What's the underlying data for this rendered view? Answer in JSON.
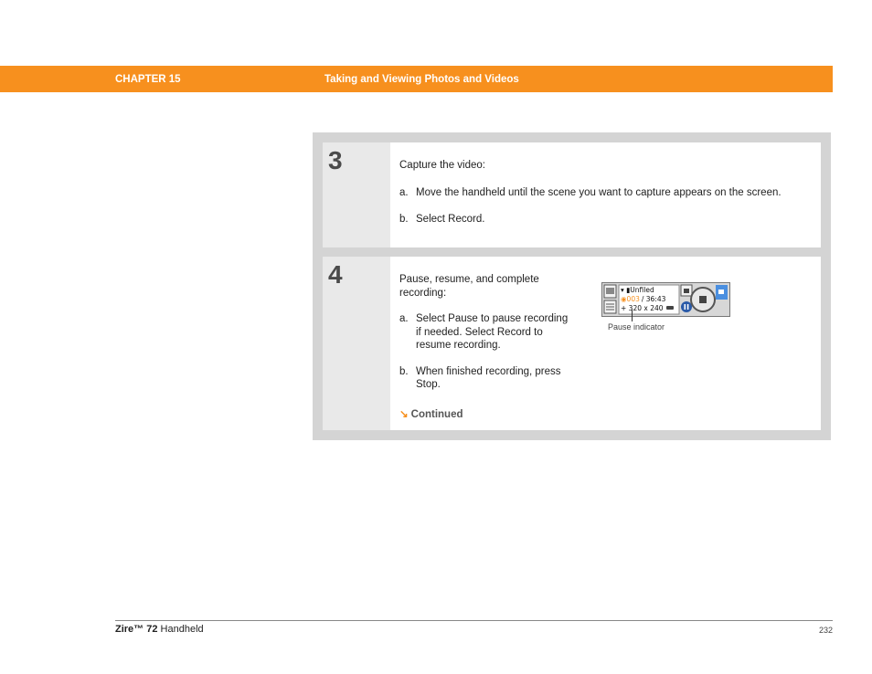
{
  "header": {
    "chapter": "CHAPTER 15",
    "title": "Taking and Viewing Photos and Videos"
  },
  "step3": {
    "number": "3",
    "intro": "Capture the video:",
    "items": [
      {
        "marker": "a.",
        "text": "Move the handheld until the scene you want to capture appears on the screen."
      },
      {
        "marker": "b.",
        "text": "Select Record."
      }
    ]
  },
  "step4": {
    "number": "4",
    "intro": "Pause, resume, and complete recording:",
    "items": [
      {
        "marker": "a.",
        "text": "Select Pause to pause recording if needed. Select Record to resume recording."
      },
      {
        "marker": "b.",
        "text": "When finished recording, press Stop."
      }
    ],
    "continued": "Continued",
    "screenshot": {
      "category": "Unfiled",
      "counter_elapsed": "003",
      "counter_total": "/ 36:43",
      "resolution": "320 x 240",
      "caption": "Pause indicator"
    }
  },
  "footer": {
    "product_brand": "Zire™ 72",
    "product_suffix": "Handheld",
    "page": "232"
  }
}
